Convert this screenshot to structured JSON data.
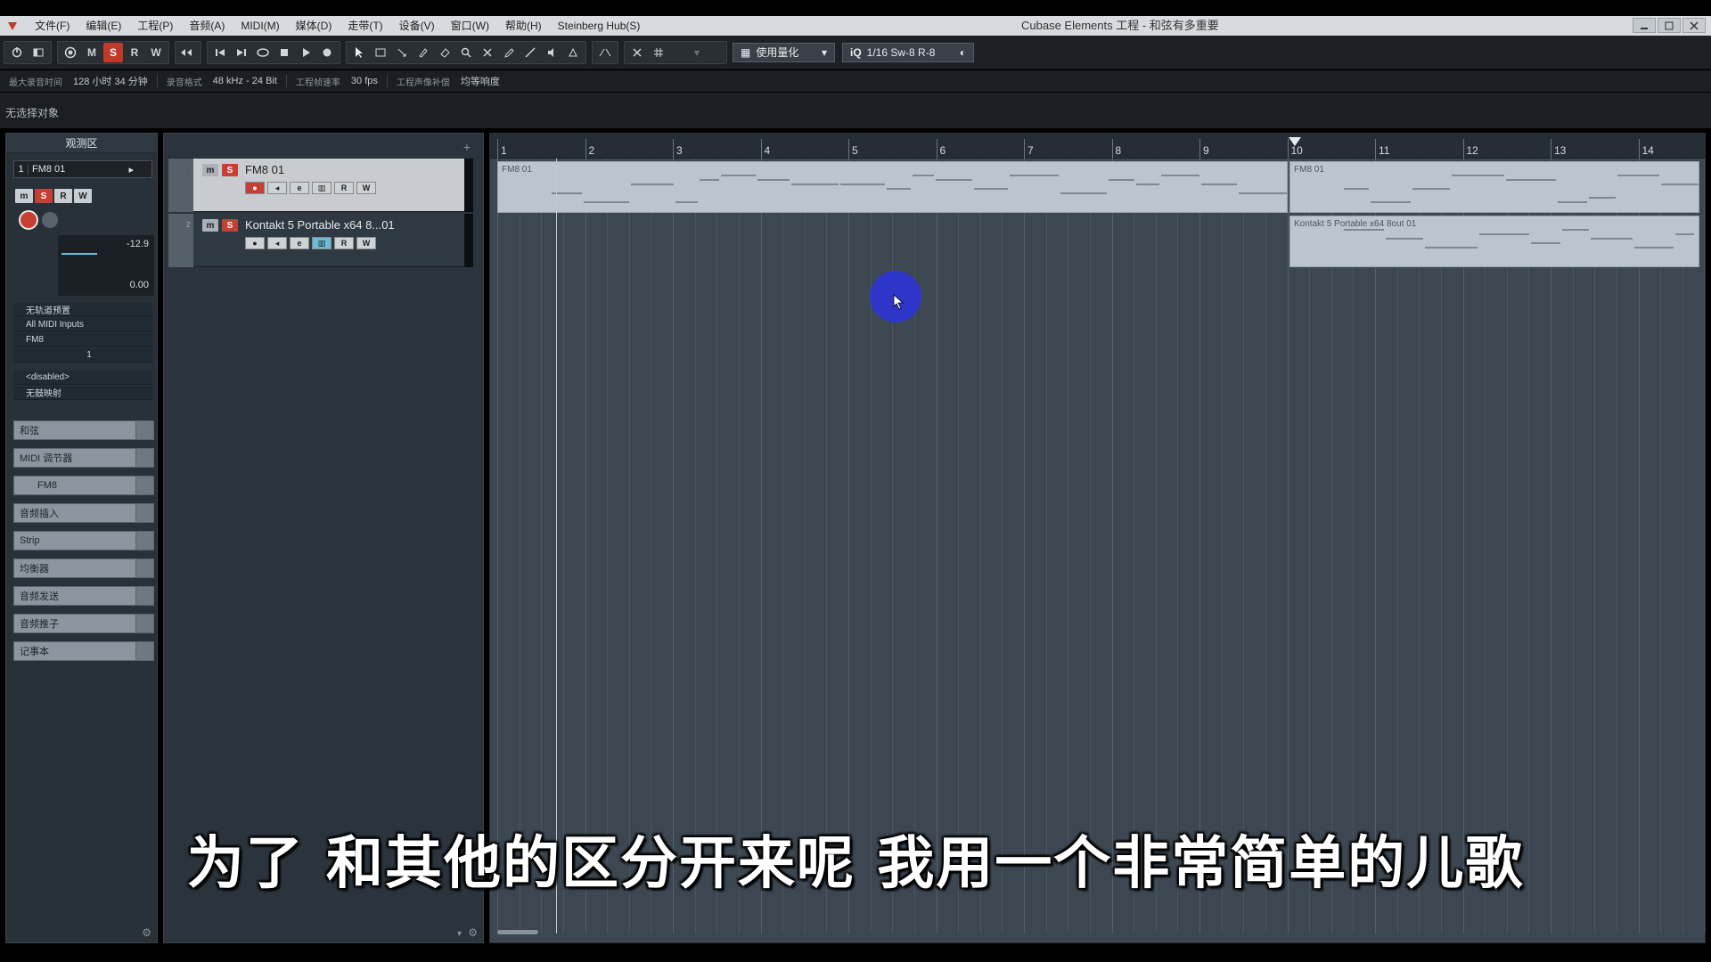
{
  "window": {
    "title": "Cubase Elements 工程 - 和弦有多重要"
  },
  "menu": [
    "文件(F)",
    "编辑(E)",
    "工程(P)",
    "音频(A)",
    "MIDI(M)",
    "媒体(D)",
    "走带(T)",
    "设备(V)",
    "窗口(W)",
    "帮助(H)",
    "Steinberg Hub(S)"
  ],
  "toolbar": {
    "m_label": "M",
    "s_label": "S",
    "r_label": "R",
    "w_label": "W",
    "quantize_label": "使用量化",
    "grid_value": "1/16 Sw-8 R-8",
    "iq_label": "iQ"
  },
  "status": {
    "rec_time_label": "最大录音时间",
    "rec_time_value": "128 小时 34 分钟",
    "format_label": "录音格式",
    "format_value": "48 kHz - 24 Bit",
    "fps_label": "工程帧速率",
    "fps_value": "30 fps",
    "pan_label": "工程声像补偿",
    "pan_value": "均等响度"
  },
  "info_line": "无选择对象",
  "inspector": {
    "title": "观测区",
    "track_number": "1",
    "track_name": "FM8 01",
    "volume": "-12.9",
    "pan": "0.00",
    "rows": [
      "无轨道预置",
      "All MIDI Inputs",
      "FM8"
    ],
    "channel": "1",
    "disabled": "<disabled>",
    "no_map": "无鼓映射",
    "sections": [
      "和弦",
      "MIDI 调节器",
      "FM8",
      "音频插入",
      "Strip",
      "均衡器",
      "音频发送",
      "音频推子",
      "记事本"
    ]
  },
  "tracks": [
    {
      "number": "1",
      "name": "FM8 01",
      "m": "m",
      "s": "S",
      "r": "R",
      "w": "W",
      "e": "e"
    },
    {
      "number": "2",
      "name": "Kontakt 5 Portable x64 8...01",
      "m": "m",
      "s": "S",
      "r": "R",
      "w": "W",
      "e": "e"
    }
  ],
  "ruler": [
    "1",
    "2",
    "3",
    "4",
    "5",
    "6",
    "7",
    "8",
    "9",
    "10",
    "11",
    "12",
    "13",
    "14"
  ],
  "events": {
    "fm8_a": "FM8 01",
    "fm8_b": "FM8 01",
    "kontakt": "Kontakt 5 Portable x64 8out 01"
  },
  "subtitle": "为了 和其他的区分开来呢 我用一个非常简单的儿歌",
  "colors": {
    "accent_red": "#c63f35",
    "cursor_blue": "#2e36c9",
    "event_bg": "#bcc5cd"
  }
}
